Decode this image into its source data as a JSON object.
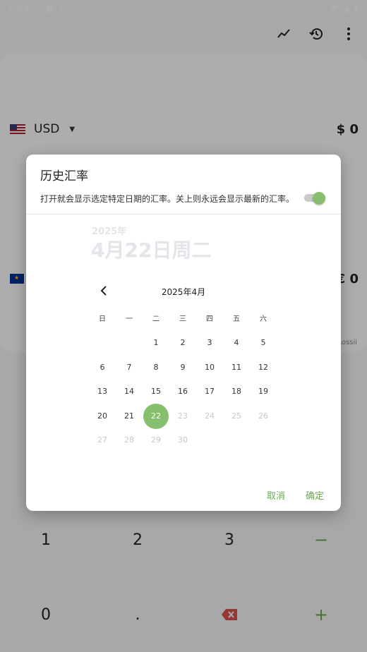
{
  "statusbar": {
    "time": "9:44"
  },
  "main": {
    "currencies": [
      {
        "code": "USD",
        "amount": "$ 0"
      },
      {
        "code": "",
        "amount": "€ 0"
      }
    ],
    "credit": "Rossii"
  },
  "keypad": {
    "keys": [
      "1",
      "2",
      "3",
      "−",
      "0",
      ".",
      "⌫",
      "+"
    ]
  },
  "dialog": {
    "title": "历史汇率",
    "description": "打开就会显示选定特定日期的汇率。关上则永远会显示最新的汇率。",
    "toggle_on": true,
    "selected_year": "2025年",
    "selected_date": "4月22日周二",
    "month_label": "2025年4月",
    "weekdays": [
      "日",
      "一",
      "二",
      "三",
      "四",
      "五",
      "六"
    ],
    "first_weekday_index": 2,
    "days_in_month": 30,
    "selected_day": 22,
    "max_day": 22,
    "cancel_label": "取消",
    "ok_label": "确定"
  },
  "colors": {
    "accent": "#86c06e",
    "accent_text": "#6aa84f"
  }
}
